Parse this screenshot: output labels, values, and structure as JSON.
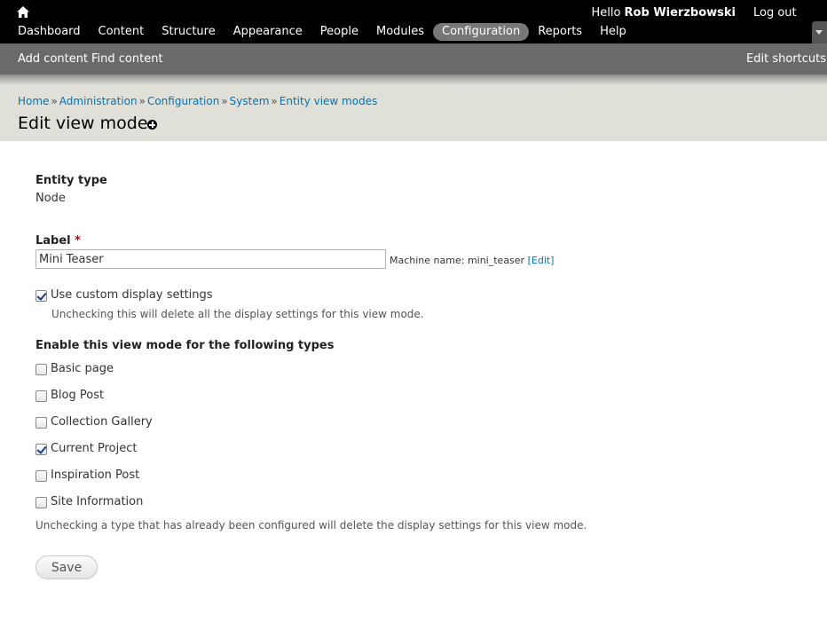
{
  "toolbar": {
    "greeting": "Hello ",
    "user_name": "Rob Wierzbowski",
    "logout": "Log out",
    "menu": [
      "Dashboard",
      "Content",
      "Structure",
      "Appearance",
      "People",
      "Modules",
      "Configuration",
      "Reports",
      "Help"
    ],
    "active_menu": "Configuration"
  },
  "shortcuts": {
    "add_content": "Add content",
    "find_content": "Find content",
    "edit_shortcuts": "Edit shortcuts"
  },
  "breadcrumb": [
    "Home",
    "Administration",
    "Configuration",
    "System",
    "Entity view modes"
  ],
  "page": {
    "title": "Edit view mode"
  },
  "form": {
    "entity_type_label": "Entity type",
    "entity_type_value": "Node",
    "label_label": "Label",
    "required_mark": "*",
    "label_value": "Mini Teaser",
    "machine_name_prefix": "Machine name: mini_teaser ",
    "machine_name_edit": "[Edit]",
    "custom_display_label": "Use custom display settings",
    "custom_display_checked": true,
    "custom_display_desc": "Unchecking this will delete all the display settings for this view mode.",
    "types_heading": "Enable this view mode for the following types",
    "types": [
      {
        "label": "Basic page",
        "checked": false
      },
      {
        "label": "Blog Post",
        "checked": false
      },
      {
        "label": "Collection Gallery",
        "checked": false
      },
      {
        "label": "Current Project",
        "checked": true
      },
      {
        "label": "Inspiration Post",
        "checked": false
      },
      {
        "label": "Site Information",
        "checked": false
      }
    ],
    "types_desc": "Unchecking a type that has already been configured will delete the display settings for this view mode.",
    "save_label": "Save"
  }
}
